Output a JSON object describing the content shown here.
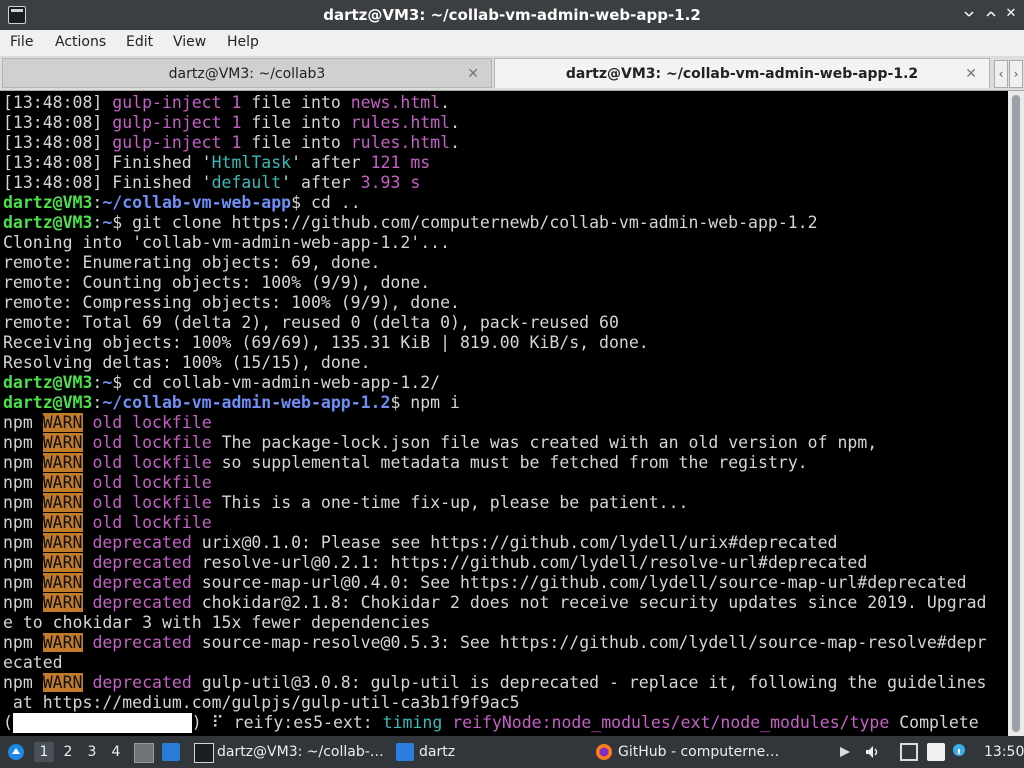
{
  "window": {
    "title": "dartz@VM3: ~/collab-vm-admin-web-app-1.2",
    "controls": {
      "close": "✕"
    }
  },
  "menu": [
    "File",
    "Actions",
    "Edit",
    "View",
    "Help"
  ],
  "tabs": [
    {
      "label": "dartz@VM3: ~/collab3",
      "active": false
    },
    {
      "label": "dartz@VM3: ~/collab-vm-admin-web-app-1.2",
      "active": true
    }
  ],
  "terminal": {
    "lines": [
      [
        {
          "t": "[13:48:08] ",
          "c": "gray"
        },
        {
          "t": "gulp-inject ",
          "c": "mag"
        },
        {
          "t": "1",
          "c": "mag"
        },
        {
          "t": " file into ",
          "c": "gray"
        },
        {
          "t": "news.html",
          "c": "mag"
        },
        {
          "t": ".",
          "c": "gray"
        }
      ],
      [
        {
          "t": "[13:48:08] ",
          "c": "gray"
        },
        {
          "t": "gulp-inject ",
          "c": "mag"
        },
        {
          "t": "1",
          "c": "mag"
        },
        {
          "t": " file into ",
          "c": "gray"
        },
        {
          "t": "rules.html",
          "c": "mag"
        },
        {
          "t": ".",
          "c": "gray"
        }
      ],
      [
        {
          "t": "[13:48:08] ",
          "c": "gray"
        },
        {
          "t": "gulp-inject ",
          "c": "mag"
        },
        {
          "t": "1",
          "c": "mag"
        },
        {
          "t": " file into ",
          "c": "gray"
        },
        {
          "t": "rules.html",
          "c": "mag"
        },
        {
          "t": ".",
          "c": "gray"
        }
      ],
      [
        {
          "t": "[13:48:08] Finished '",
          "c": "gray"
        },
        {
          "t": "HtmlTask",
          "c": "cyan"
        },
        {
          "t": "' after ",
          "c": "gray"
        },
        {
          "t": "121 ms",
          "c": "mag"
        }
      ],
      [
        {
          "t": "[13:48:08] Finished '",
          "c": "gray"
        },
        {
          "t": "default",
          "c": "cyan"
        },
        {
          "t": "' after ",
          "c": "gray"
        },
        {
          "t": "3.93 s",
          "c": "mag"
        }
      ],
      [
        {
          "t": "dartz@VM3",
          "c": "green"
        },
        {
          "t": ":",
          "c": "gray"
        },
        {
          "t": "~/collab-vm-web-app",
          "c": "blue"
        },
        {
          "t": "$ cd ..",
          "c": "gray"
        }
      ],
      [
        {
          "t": "dartz@VM3",
          "c": "green"
        },
        {
          "t": ":",
          "c": "gray"
        },
        {
          "t": "~",
          "c": "blue"
        },
        {
          "t": "$ git clone https://github.com/computernewb/collab-vm-admin-web-app-1.2",
          "c": "gray"
        }
      ],
      [
        {
          "t": "Cloning into 'collab-vm-admin-web-app-1.2'...",
          "c": "gray"
        }
      ],
      [
        {
          "t": "remote: Enumerating objects: 69, done.",
          "c": "gray"
        }
      ],
      [
        {
          "t": "remote: Counting objects: 100% (9/9), done.",
          "c": "gray"
        }
      ],
      [
        {
          "t": "remote: Compressing objects: 100% (9/9), done.",
          "c": "gray"
        }
      ],
      [
        {
          "t": "remote: Total 69 (delta 2), reused 0 (delta 0), pack-reused 60",
          "c": "gray"
        }
      ],
      [
        {
          "t": "Receiving objects: 100% (69/69), 135.31 KiB | 819.00 KiB/s, done.",
          "c": "gray"
        }
      ],
      [
        {
          "t": "Resolving deltas: 100% (15/15), done.",
          "c": "gray"
        }
      ],
      [
        {
          "t": "dartz@VM3",
          "c": "green"
        },
        {
          "t": ":",
          "c": "gray"
        },
        {
          "t": "~",
          "c": "blue"
        },
        {
          "t": "$ cd collab-vm-admin-web-app-1.2/",
          "c": "gray"
        }
      ],
      [
        {
          "t": "dartz@VM3",
          "c": "green"
        },
        {
          "t": ":",
          "c": "gray"
        },
        {
          "t": "~/collab-vm-admin-web-app-1.2",
          "c": "blue"
        },
        {
          "t": "$ npm i",
          "c": "gray"
        }
      ],
      [
        {
          "t": "npm ",
          "c": "gray"
        },
        {
          "t": "WARN",
          "c": "warn"
        },
        {
          "t": " ",
          "c": "gray"
        },
        {
          "t": "old lockfile",
          "c": "mag"
        }
      ],
      [
        {
          "t": "npm ",
          "c": "gray"
        },
        {
          "t": "WARN",
          "c": "warn"
        },
        {
          "t": " ",
          "c": "gray"
        },
        {
          "t": "old lockfile",
          "c": "mag"
        },
        {
          "t": " The package-lock.json file was created with an old version of npm,",
          "c": "gray"
        }
      ],
      [
        {
          "t": "npm ",
          "c": "gray"
        },
        {
          "t": "WARN",
          "c": "warn"
        },
        {
          "t": " ",
          "c": "gray"
        },
        {
          "t": "old lockfile",
          "c": "mag"
        },
        {
          "t": " so supplemental metadata must be fetched from the registry.",
          "c": "gray"
        }
      ],
      [
        {
          "t": "npm ",
          "c": "gray"
        },
        {
          "t": "WARN",
          "c": "warn"
        },
        {
          "t": " ",
          "c": "gray"
        },
        {
          "t": "old lockfile",
          "c": "mag"
        }
      ],
      [
        {
          "t": "npm ",
          "c": "gray"
        },
        {
          "t": "WARN",
          "c": "warn"
        },
        {
          "t": " ",
          "c": "gray"
        },
        {
          "t": "old lockfile",
          "c": "mag"
        },
        {
          "t": " This is a one-time fix-up, please be patient...",
          "c": "gray"
        }
      ],
      [
        {
          "t": "npm ",
          "c": "gray"
        },
        {
          "t": "WARN",
          "c": "warn"
        },
        {
          "t": " ",
          "c": "gray"
        },
        {
          "t": "old lockfile",
          "c": "mag"
        }
      ],
      [
        {
          "t": "npm ",
          "c": "gray"
        },
        {
          "t": "WARN",
          "c": "warn"
        },
        {
          "t": " ",
          "c": "gray"
        },
        {
          "t": "deprecated",
          "c": "mag"
        },
        {
          "t": " urix@0.1.0: Please see https://github.com/lydell/urix#deprecated",
          "c": "gray"
        }
      ],
      [
        {
          "t": "npm ",
          "c": "gray"
        },
        {
          "t": "WARN",
          "c": "warn"
        },
        {
          "t": " ",
          "c": "gray"
        },
        {
          "t": "deprecated",
          "c": "mag"
        },
        {
          "t": " resolve-url@0.2.1: https://github.com/lydell/resolve-url#deprecated",
          "c": "gray"
        }
      ],
      [
        {
          "t": "npm ",
          "c": "gray"
        },
        {
          "t": "WARN",
          "c": "warn"
        },
        {
          "t": " ",
          "c": "gray"
        },
        {
          "t": "deprecated",
          "c": "mag"
        },
        {
          "t": " source-map-url@0.4.0: See https://github.com/lydell/source-map-url#deprecated",
          "c": "gray"
        }
      ],
      [
        {
          "t": "npm ",
          "c": "gray"
        },
        {
          "t": "WARN",
          "c": "warn"
        },
        {
          "t": " ",
          "c": "gray"
        },
        {
          "t": "deprecated",
          "c": "mag"
        },
        {
          "t": " chokidar@2.1.8: Chokidar 2 does not receive security updates since 2019. Upgrad",
          "c": "gray"
        }
      ],
      [
        {
          "t": "e to chokidar 3 with 15x fewer dependencies",
          "c": "gray"
        }
      ],
      [
        {
          "t": "npm ",
          "c": "gray"
        },
        {
          "t": "WARN",
          "c": "warn"
        },
        {
          "t": " ",
          "c": "gray"
        },
        {
          "t": "deprecated",
          "c": "mag"
        },
        {
          "t": " source-map-resolve@0.5.3: See https://github.com/lydell/source-map-resolve#depr",
          "c": "gray"
        }
      ],
      [
        {
          "t": "ecated",
          "c": "gray"
        }
      ],
      [
        {
          "t": "npm ",
          "c": "gray"
        },
        {
          "t": "WARN",
          "c": "warn"
        },
        {
          "t": " ",
          "c": "gray"
        },
        {
          "t": "deprecated",
          "c": "mag"
        },
        {
          "t": " gulp-util@3.0.8: gulp-util is deprecated - replace it, following the guidelines",
          "c": "gray"
        }
      ],
      [
        {
          "t": " at https://medium.com/gulpjs/gulp-util-ca3b1f9f9ac5",
          "c": "gray"
        }
      ],
      [
        {
          "t": "(",
          "c": "gray"
        },
        {
          "t": "                  ",
          "c": "redact"
        },
        {
          "t": ") ⠏ reify:es5-ext: ",
          "c": "gray"
        },
        {
          "t": "timing",
          "c": "cyan"
        },
        {
          "t": " ",
          "c": "gray"
        },
        {
          "t": "reifyNode:node_modules/ext/node_modules/type",
          "c": "mag"
        },
        {
          "t": " Complete",
          "c": "gray"
        }
      ]
    ]
  },
  "taskbar": {
    "workspaces": [
      "1",
      "2",
      "3",
      "4"
    ],
    "tasks": [
      {
        "label": "dartz@VM3: ~/collab-…",
        "icon": "terminal-icon"
      },
      {
        "label": "dartz",
        "icon": "folder-icon"
      },
      {
        "label": "GitHub - computerne…",
        "icon": "firefox-icon"
      }
    ],
    "clock": "13:50"
  }
}
